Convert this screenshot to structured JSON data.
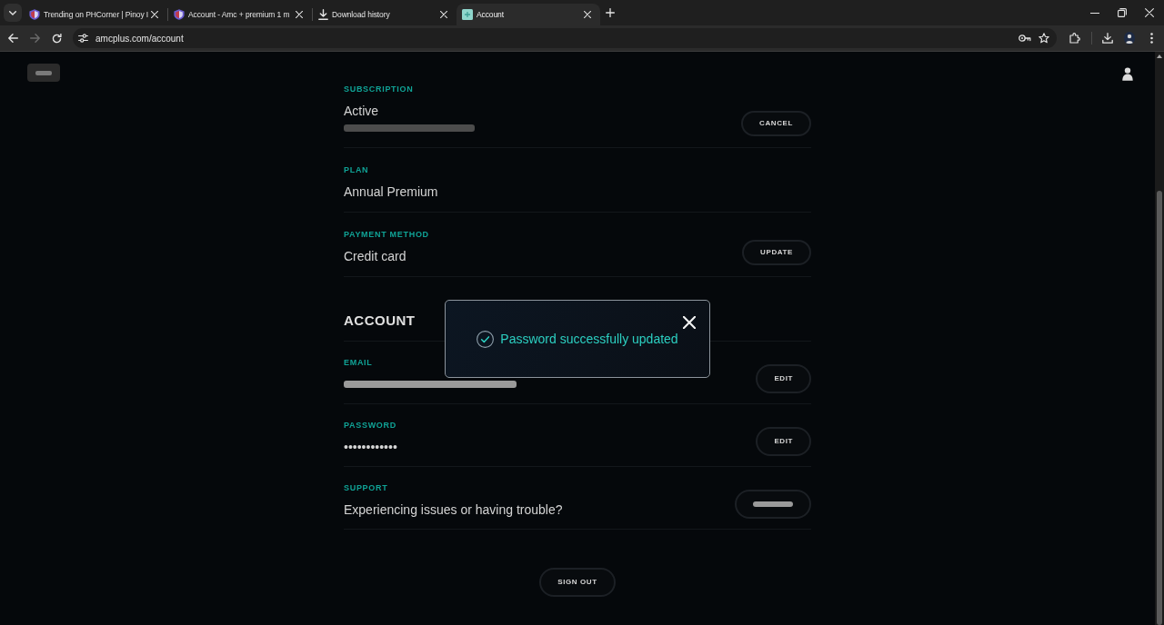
{
  "browser": {
    "tabs": [
      {
        "kind": "site",
        "title": "Trending on PHCorner | Pinoy I",
        "selected": false
      },
      {
        "kind": "site",
        "title": "Account - Amc + premium 1 m",
        "selected": false
      },
      {
        "kind": "download",
        "title": "Download history",
        "selected": false
      },
      {
        "kind": "page",
        "title": "Account",
        "selected": true
      }
    ],
    "nav_buttons": [
      {
        "disabled": false
      },
      {
        "disabled": true
      },
      {
        "disabled": false
      }
    ],
    "address": "amcplus.com/account"
  },
  "page": {
    "top_chip": {
      "label_blurred": true
    },
    "plan_rows": [
      {
        "label": "SUBSCRIPTION",
        "value": "Active",
        "subline_blurred": true,
        "button": "CANCEL"
      },
      {
        "label": "PLAN",
        "value": "Annual Premium"
      },
      {
        "label": "PAYMENT METHOD",
        "value": "Credit card",
        "button": "UPDATE"
      }
    ],
    "account_heading": "ACCOUNT",
    "account_rows": [
      {
        "label": "EMAIL",
        "value_blurred": true,
        "button": "EDIT"
      },
      {
        "label": "PASSWORD",
        "value": "••••••••••••",
        "button": "EDIT"
      },
      {
        "label": "SUPPORT",
        "value": "Experiencing issues or having trouble?",
        "button_blurred": true
      }
    ],
    "sign_out": "SIGN OUT"
  },
  "toast": {
    "message": "Password successfully updated"
  }
}
